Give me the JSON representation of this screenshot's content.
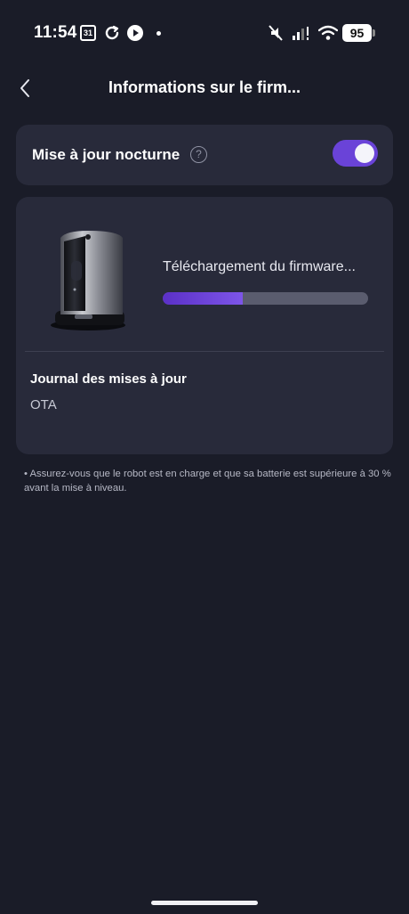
{
  "status_bar": {
    "time": "11:54",
    "calendar_day": "31",
    "battery": "95"
  },
  "header": {
    "title": "Informations sur le firm..."
  },
  "night_update": {
    "label": "Mise à jour nocturne",
    "help_glyph": "?",
    "enabled": true
  },
  "firmware": {
    "status": "Téléchargement du firmware...",
    "progress_percent": 39,
    "log_title": "Journal des mises à jour",
    "log_entry": "OTA"
  },
  "notice": "• Assurez-vous que le robot est en charge et que sa batterie est supérieure à 30 % avant la mise à niveau.",
  "colors": {
    "background": "#1a1c28",
    "card": "#282a3a",
    "accent": "#6a43d8"
  }
}
